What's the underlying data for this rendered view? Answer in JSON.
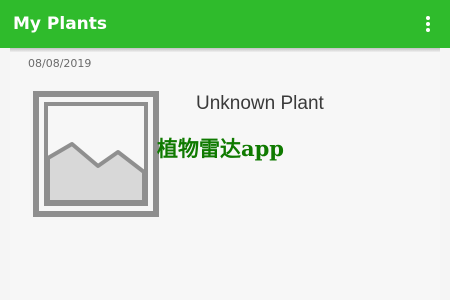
{
  "app_bar": {
    "title": "My Plants",
    "overflow_icon": "more-vert-icon",
    "color": "#2fbb2c"
  },
  "list": {
    "date": "08/08/2019",
    "items": [
      {
        "name": "Unknown Plant",
        "thumbnail_icon": "image-placeholder-icon"
      }
    ]
  },
  "watermark": {
    "text": "植物雷达app",
    "color": "#0f7a00"
  }
}
